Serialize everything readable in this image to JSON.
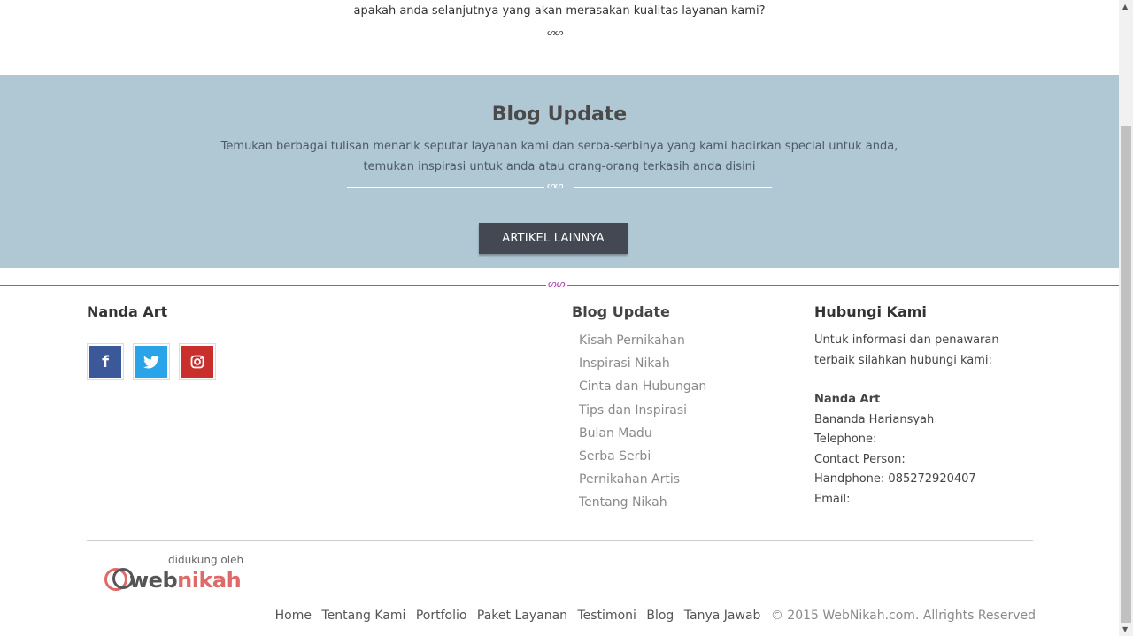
{
  "top": {
    "text": "apakah anda selanjutnya yang akan merasakan kualitas layanan kami?"
  },
  "blog_section": {
    "title": "Blog Update",
    "desc_line1": "Temukan berbagai tulisan menarik seputar layanan kami dan serba-serbinya yang kami hadirkan special untuk anda,",
    "desc_line2": "temukan inspirasi untuk anda atau orang-orang terkasih anda disini",
    "button": "ARTIKEL LAINNYA",
    "background": "#b0c7d4"
  },
  "footer": {
    "brand": {
      "title": "Nanda Art",
      "social": [
        {
          "icon": "facebook-icon",
          "glyph": "f",
          "color": "#3b5998"
        },
        {
          "icon": "twitter-icon",
          "glyph": "🐦",
          "color": "#2aa4e8"
        },
        {
          "icon": "instagram-icon",
          "glyph": "◎",
          "color": "#c9302c"
        }
      ]
    },
    "blog": {
      "title": "Blog Update",
      "items": [
        "Kisah Pernikahan",
        "Inspirasi Nikah",
        "Cinta dan Hubungan",
        "Tips dan Inspirasi",
        "Bulan Madu",
        "Serba Serbi",
        "Pernikahan Artis",
        "Tentang Nikah"
      ]
    },
    "contact": {
      "title": "Hubungi Kami",
      "intro": "Untuk informasi dan penawaran terbaik silahkan hubungi kami:",
      "name": "Nanda Art",
      "person": "Bananda Hariansyah",
      "telephone": "Telephone:",
      "contact_person": "Contact Person:",
      "handphone": "Handphone: 085272920407",
      "email": "Email:"
    },
    "logo": {
      "by": "didukung oleh",
      "web": "web",
      "nikah": "nikah"
    },
    "nav": [
      "Home",
      "Tentang Kami",
      "Portfolio",
      "Paket Layanan",
      "Testimoni",
      "Blog",
      "Tanya Jawab"
    ],
    "copyright": "© 2015 WebNikah.com. Allrights Reserved",
    "accent": "#b24ba6"
  }
}
